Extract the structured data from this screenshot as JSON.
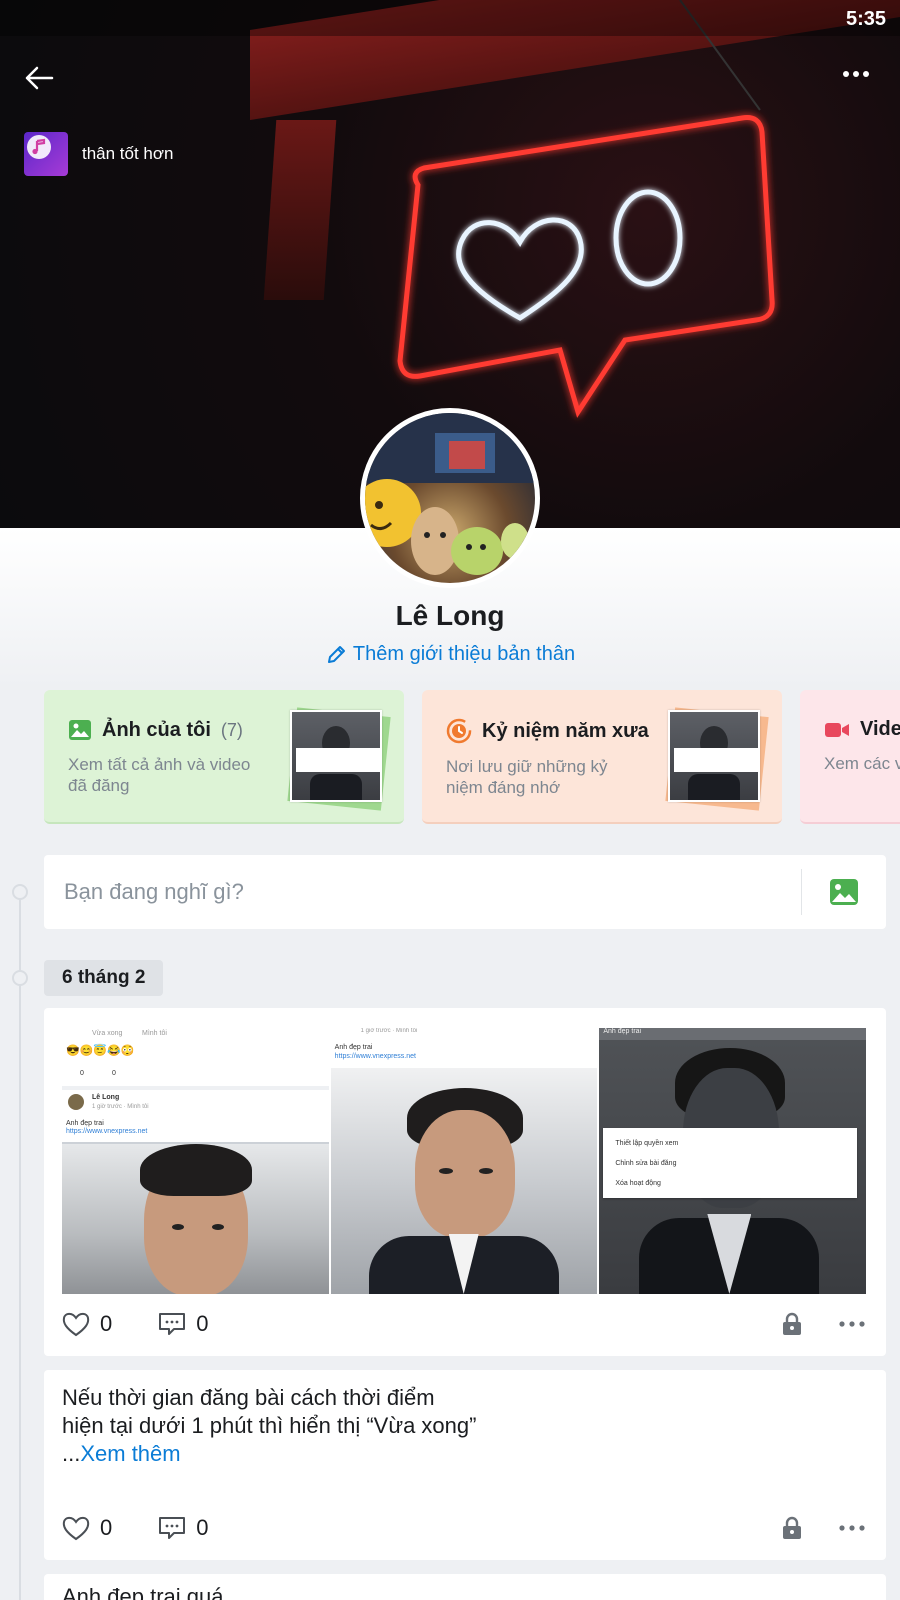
{
  "status_bar": {
    "time": "5:35"
  },
  "header": {
    "music_title": "thân tốt hơn"
  },
  "profile": {
    "name": "Lê Long",
    "intro_link": "Thêm giới thiệu bản thân"
  },
  "cards": [
    {
      "title": "Ảnh của tôi",
      "count": "(7)",
      "desc": "Xem tất cả ảnh và video đã đăng",
      "accent": "#4caf50"
    },
    {
      "title": "Kỷ niệm năm xưa",
      "desc": "Nơi lưu giữ những kỷ niệm đáng nhớ",
      "accent": "#f07a2f"
    },
    {
      "title": "Vide",
      "desc": "Xem các v",
      "accent": "#e8485d"
    }
  ],
  "composer": {
    "placeholder": "Bạn đang nghĩ gì?"
  },
  "timeline": {
    "date_label": "6 tháng 2"
  },
  "post1": {
    "likes": "0",
    "comments": "0",
    "photo1": {
      "time_text": "Vừa xong",
      "privacy_text": "Mình tôi",
      "emojis": "😎😊😇😂😳",
      "like_count": "0",
      "comment_count": "0",
      "author": "Lê Long",
      "meta": "1 giờ trước · Mình tôi",
      "caption": "Anh đẹp trai",
      "link": "https://www.vnexpress.net"
    },
    "photo2": {
      "meta": "1 giờ trước · Mình tôi",
      "caption": "Anh đẹp trai",
      "link": "https://www.vnexpress.net"
    },
    "photo3": {
      "caption": "Anh đẹp trai",
      "menu": [
        "Thiết lập quyền xem",
        "Chỉnh sửa bài đăng",
        "Xóa hoạt động"
      ]
    }
  },
  "post2": {
    "text": "Nếu thời gian đăng bài cách thời điểm hiện tại dưới 1 phút thì hiển thị “Vừa xong”",
    "ellipsis": "...",
    "see_more": "Xem thêm",
    "likes": "0",
    "comments": "0"
  },
  "post3": {
    "text": "Anh đẹp trai quá"
  },
  "colors": {
    "link": "#0a7cd6",
    "background": "#eef0f3"
  }
}
